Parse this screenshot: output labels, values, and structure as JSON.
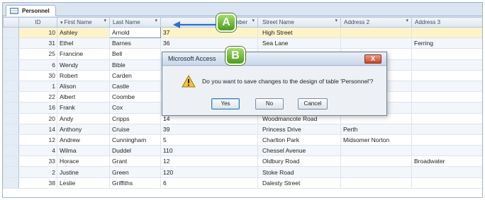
{
  "tab": {
    "label": "Personnel"
  },
  "columns": [
    {
      "label": "ID"
    },
    {
      "label": "First Name"
    },
    {
      "label": "Last Name"
    },
    {
      "label": "umber"
    },
    {
      "label": "Street Name"
    },
    {
      "label": "Address 2"
    },
    {
      "label": "Address 3"
    }
  ],
  "rows": [
    {
      "id": "10",
      "first": "Ashley",
      "last": "Arnold",
      "num": "37",
      "street": "High Street",
      "addr2": "",
      "addr3": ""
    },
    {
      "id": "31",
      "first": "Ethel",
      "last": "Barnes",
      "num": "36",
      "street": "Sea Lane",
      "addr2": "",
      "addr3": "Ferring"
    },
    {
      "id": "25",
      "first": "Francine",
      "last": "Bell",
      "num": "",
      "street": "",
      "addr2": "",
      "addr3": ""
    },
    {
      "id": "6",
      "first": "Wendy",
      "last": "Bible",
      "num": "",
      "street": "",
      "addr2": "",
      "addr3": ""
    },
    {
      "id": "30",
      "first": "Robert",
      "last": "Carden",
      "num": "",
      "street": "",
      "addr2": "",
      "addr3": ""
    },
    {
      "id": "1",
      "first": "Alison",
      "last": "Castle",
      "num": "",
      "street": "",
      "addr2": "",
      "addr3": ""
    },
    {
      "id": "22",
      "first": "Albert",
      "last": "Coombe",
      "num": "",
      "street": "",
      "addr2": "",
      "addr3": ""
    },
    {
      "id": "16",
      "first": "Frank",
      "last": "Cox",
      "num": "",
      "street": "",
      "addr2": "",
      "addr3": ""
    },
    {
      "id": "20",
      "first": "Andy",
      "last": "Cripps",
      "num": "14",
      "street": "Woodmancote Road",
      "addr2": "",
      "addr3": ""
    },
    {
      "id": "14",
      "first": "Anthony",
      "last": "Cruise",
      "num": "39",
      "street": "Princess Drive",
      "addr2": "Perth",
      "addr3": ""
    },
    {
      "id": "12",
      "first": "Andrew",
      "last": "Cunningham",
      "num": "5",
      "street": "Charlton Park",
      "addr2": "Midsomer Norton",
      "addr3": ""
    },
    {
      "id": "4",
      "first": "Wilma",
      "last": "Duddel",
      "num": "110",
      "street": "Chessel Avenue",
      "addr2": "",
      "addr3": ""
    },
    {
      "id": "33",
      "first": "Horace",
      "last": "Grant",
      "num": "12",
      "street": "Oldbury Road",
      "addr2": "",
      "addr3": "Broadwater"
    },
    {
      "id": "2",
      "first": "Justine",
      "last": "Green",
      "num": "120",
      "street": "Stoke Road",
      "addr2": "",
      "addr3": ""
    },
    {
      "id": "38",
      "first": "Leslie",
      "last": "Griffiths",
      "num": "6",
      "street": "Dalesty Street",
      "addr2": "",
      "addr3": ""
    }
  ],
  "dialog": {
    "title": "Microsoft Access",
    "message": "Do you want to save changes to the design of table 'Personnel'?",
    "yes": "Yes",
    "no": "No",
    "cancel": "Cancel",
    "close": "X"
  },
  "callouts": {
    "a": "A",
    "b": "B"
  },
  "colors": {
    "callout_green": "#4e9c1e",
    "arrow_blue": "#2f6fd0",
    "current_row": "#fcf3c9",
    "warning_yellow": "#f4c430"
  },
  "icons": [
    "table-icon",
    "dropdown-arrow-icon",
    "warning-icon",
    "close-icon",
    "callout-arrow-icon"
  ]
}
